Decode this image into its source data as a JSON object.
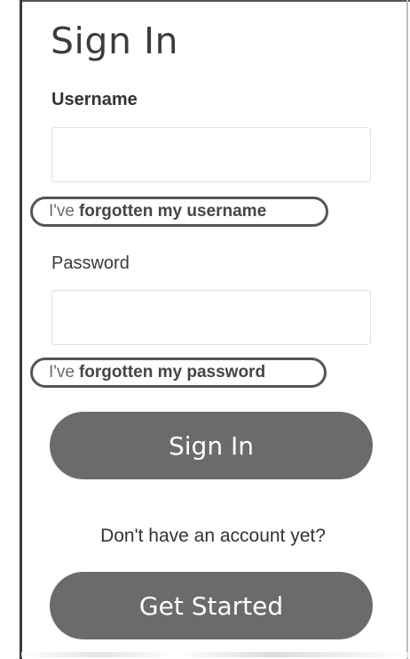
{
  "header": {
    "title": "Sign In"
  },
  "form": {
    "username": {
      "label": "Username",
      "value": "",
      "placeholder": ""
    },
    "forgot_username": {
      "prefix": "I've",
      "link_text": "forgotten my username"
    },
    "password": {
      "label": "Password",
      "value": "",
      "placeholder": ""
    },
    "forgot_password": {
      "prefix": "I've",
      "link_text": "forgotten my password"
    },
    "sign_in_button": "Sign In"
  },
  "signup": {
    "prompt": "Don't have an account yet?",
    "button": "Get Started"
  },
  "colors": {
    "button_bg": "#6b6b6b",
    "button_text": "#ffffff",
    "text": "#333333",
    "highlight_outline": "#555555"
  }
}
